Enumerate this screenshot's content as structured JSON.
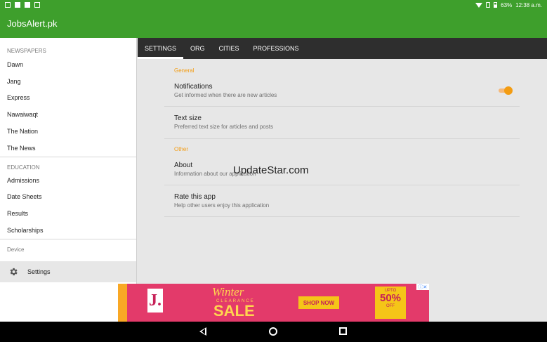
{
  "status_bar": {
    "battery": "63%",
    "time": "12:38 a.m."
  },
  "app_bar": {
    "title": "JobsAlert.pk"
  },
  "drawer": {
    "sections": [
      {
        "header": "NEWSPAPERS",
        "items": [
          "Dawn",
          "Jang",
          "Express",
          "Nawaiwaqt",
          "The Nation",
          "The News"
        ]
      },
      {
        "header": "EDUCATION",
        "items": [
          "Admissions",
          "Date Sheets",
          "Results",
          "Scholarships"
        ]
      },
      {
        "header": "Device",
        "items": []
      }
    ],
    "settings_label": "Settings"
  },
  "tabs": [
    "SETTINGS",
    "ORG",
    "CITIES",
    "PROFESSIONS"
  ],
  "active_tab": "SETTINGS",
  "settings": {
    "general_header": "General",
    "notifications": {
      "title": "Notifications",
      "summary": "Get informed when there are new articles",
      "enabled": true
    },
    "text_size": {
      "title": "Text size",
      "summary": "Preferred text size for articles and posts"
    },
    "other_header": "Other",
    "about": {
      "title": "About",
      "summary": "Information about our application"
    },
    "rate": {
      "title": "Rate this app",
      "summary": "Help other users enjoy this application"
    }
  },
  "watermark": "UpdateStar.com",
  "ad": {
    "logo": "J.",
    "headline_top": "Winter",
    "headline_small": "CLEARANCE",
    "headline_main": "SALE",
    "cta": "SHOP NOW",
    "tag_small": "UPTO",
    "tag_big": "50%",
    "tag_suffix": "OFF",
    "close": "ⓘ✕"
  },
  "colors": {
    "primary": "#3e9f2c",
    "accent": "#f39c12",
    "tabbar": "#2e2e2e",
    "ad": "#e33a6a"
  },
  "icons": {
    "settings": "gear-icon",
    "back": "back-icon",
    "home": "home-icon",
    "recents": "recents-icon"
  }
}
